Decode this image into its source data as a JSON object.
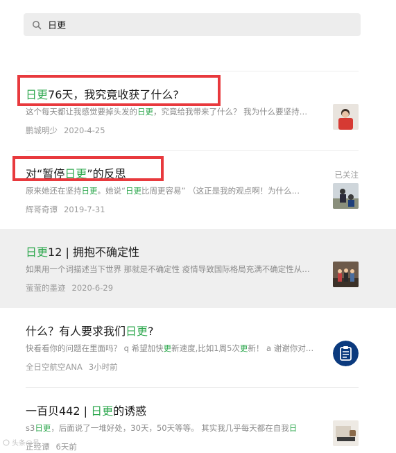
{
  "search": {
    "value": "日更"
  },
  "results": [
    {
      "title_hl": "日更",
      "title_rest": "76天，我究竟收获了什么?",
      "snippet_a": "这个每天都让我感觉要掉头发的",
      "snippet_hl": "日更",
      "snippet_b": "，究竟给我带来了什么？ 我为什么要坚持…",
      "author": "鹏城明少",
      "date": "2020-4-25"
    },
    {
      "title_a": "对“暂停",
      "title_hl": "日更",
      "title_b": "”的反思",
      "followed": "已关注",
      "snippet_a": "原来她还在坚持",
      "snippet_hl": "日更",
      "snippet_b": "。她说“",
      "snippet_hl2": "日更",
      "snippet_c": "比周更容易” （这正是我的观点啊！为什么…",
      "author": "辉哥奇谭",
      "date": "2019-7-31"
    },
    {
      "title_hl": "日更",
      "title_rest": "12 | 拥抱不确定性",
      "snippet": "如果用一个词描述当下世界 那就是不确定性 疫情导致国际格局充满不确定性从…",
      "author": "萤萤的墨迹",
      "date": "2020-6-29"
    },
    {
      "title_a": "什么？有人要求我们",
      "title_hl": "日更",
      "title_b": "?",
      "snippet_a": "快看看你的问题在里面吗？ q 希望加快",
      "snippet_hl": "更",
      "snippet_b": "新速度,比如1周5次",
      "snippet_hl2": "更",
      "snippet_c": "新！ a 谢谢你对…",
      "author": "全日空航空ANA",
      "date": "3小时前"
    },
    {
      "title_a": "一百贝442 | ",
      "title_hl": "日更",
      "title_b": "的诱惑",
      "snippet_a": "s3",
      "snippet_hl": "日更",
      "snippet_b": "，后面说了一堆好处，30天，50天等等。 其实我几乎每天都在自我",
      "snippet_hl2": "日",
      "author": "正经谭",
      "date": "6天前"
    }
  ],
  "watermark": "头条@号"
}
